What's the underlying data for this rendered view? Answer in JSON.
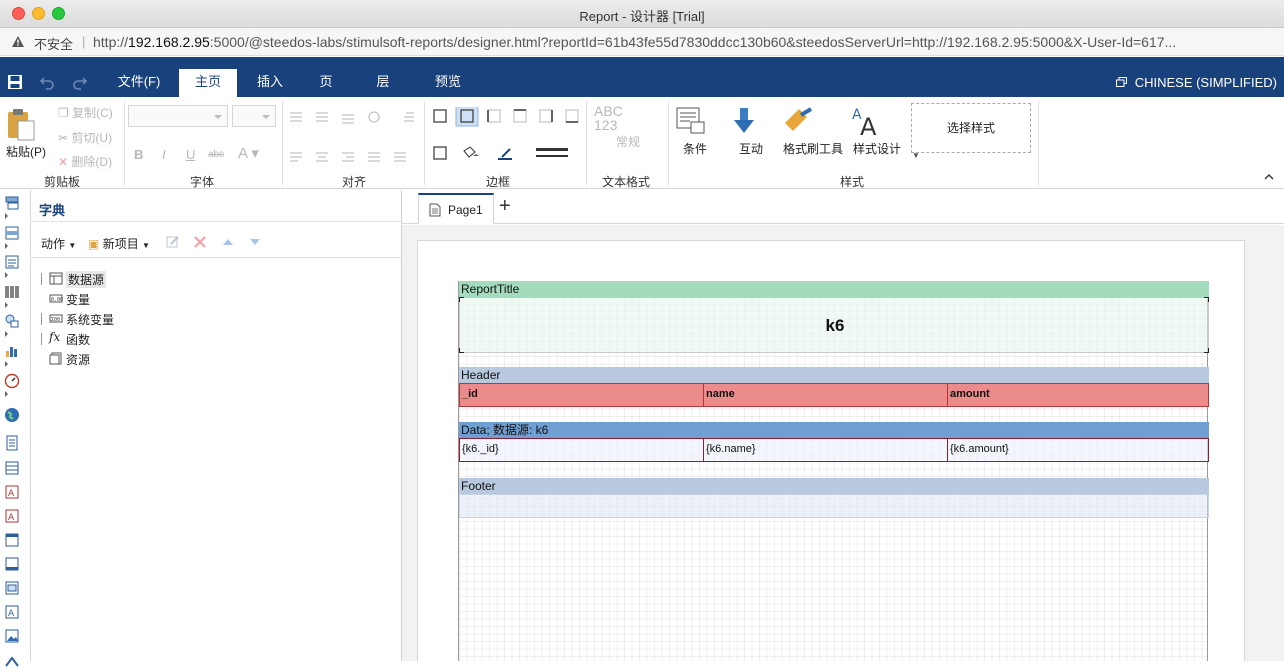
{
  "window": {
    "title": "Report - 设计器 [Trial]"
  },
  "address_bar": {
    "security_text": "不安全",
    "url_prefix": "http://",
    "url_host": "192.168.2.95",
    "url_rest": ":5000/@steedos-labs/stimulsoft-reports/designer.html?reportId=61b43fe55d7830ddcc130b60&steedosServerUrl=http://192.168.2.95:5000&X-User-Id=617..."
  },
  "ribbon_tabs": [
    {
      "label": "文件(F)",
      "active": false
    },
    {
      "label": "主页",
      "active": true
    },
    {
      "label": "插入",
      "active": false
    },
    {
      "label": "页",
      "active": false
    },
    {
      "label": "层",
      "active": false
    },
    {
      "label": "预览",
      "active": false
    }
  ],
  "language": "CHINESE (SIMPLIFIED)",
  "ribbon": {
    "clipboard": {
      "paste": "粘贴(P)",
      "copy": "复制(C)",
      "cut": "剪切(U)",
      "delete": "删除(D)",
      "label": "剪贴板"
    },
    "font": {
      "label": "字体"
    },
    "align": {
      "label": "对齐"
    },
    "border": {
      "label": "边框"
    },
    "text_format": {
      "sample": "ABC\n123",
      "normal": "常规",
      "label": "文本格式"
    },
    "style": {
      "condition": "条件",
      "interaction": "互动",
      "format_painter": "格式刷工具",
      "style_design": "样式设计",
      "select_style": "选择样式",
      "label": "样式"
    }
  },
  "dictionary": {
    "title": "字典",
    "actions": "动作",
    "new_item": "新项目",
    "tree": [
      {
        "label": "数据源",
        "expandable": true,
        "selected": true,
        "icon": "datasource-icon"
      },
      {
        "label": "变量",
        "expandable": false,
        "selected": false,
        "icon": "variable-icon"
      },
      {
        "label": "系统变量",
        "expandable": true,
        "selected": false,
        "icon": "system-variable-icon"
      },
      {
        "label": "函数",
        "expandable": true,
        "selected": false,
        "icon": "function-icon"
      },
      {
        "label": "资源",
        "expandable": false,
        "selected": false,
        "icon": "resource-icon"
      }
    ]
  },
  "pages": {
    "active": "Page1",
    "add": "+"
  },
  "report": {
    "title_band": "ReportTitle",
    "title_text": "k6",
    "header_band": "Header",
    "header_cells": [
      "_id",
      "name",
      "amount"
    ],
    "data_band": "Data; 数据源: k6",
    "data_cells": [
      "{k6._id}",
      "{k6.name}",
      "{k6.amount}"
    ],
    "footer_band": "Footer"
  },
  "colors": {
    "ribbon_blue": "#19427c",
    "title_band": "#a3dbbd",
    "header_band": "#b8c9e0",
    "data_band": "#6f9fd3",
    "header_row": "#ec8b8b"
  }
}
